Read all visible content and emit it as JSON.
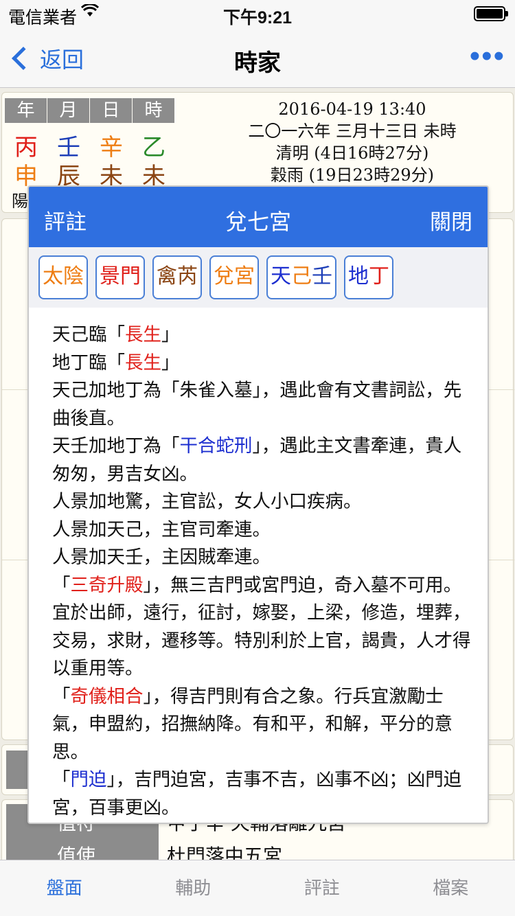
{
  "status": {
    "carrier": "電信業者",
    "time": "下午9:21"
  },
  "nav": {
    "back_label": "返回",
    "title": "時家",
    "more_label": "•••"
  },
  "info": {
    "pillar_headers": [
      "年",
      "月",
      "日",
      "時"
    ],
    "stems": [
      "丙",
      "壬",
      "辛",
      "乙"
    ],
    "branches": [
      "申",
      "辰",
      "未",
      "未"
    ],
    "yinyang": "陽",
    "datetime": "2016-04-19 13:40",
    "lunar_date": "二〇一六年 三月十三日 未時",
    "solar_term_1": "清明 (4日16時27分)",
    "solar_term_2": "穀雨 (19日23時29分)"
  },
  "bottom": {
    "row1_label": "值符",
    "row1_value": "甲子辛 天輔落離九宮",
    "row2_label": "值使",
    "row2_value": "杜門落中五宮"
  },
  "modal": {
    "left_label": "評註",
    "title": "兌七宮",
    "right_label": "關閉",
    "tags": [
      "太陰",
      "景門",
      "禽芮",
      "兌宮",
      "天己壬",
      "地丁"
    ],
    "tag_colors": {
      "太陰": "#ee7d13",
      "景門": "#e0201a",
      "禽芮": "#8b4513",
      "兌宮": "#ee7d13"
    },
    "body": {
      "l1_pre": "天己臨「",
      "l1_hl": "長生",
      "l1_post": "」",
      "l2_pre": "地丁臨「",
      "l2_hl": "長生",
      "l2_post": "」",
      "l3": "天己加地丁為「朱雀入墓」，遇此會有文書詞訟，先曲後直。",
      "l4_pre": "天壬加地丁為「",
      "l4_hl": "干合蛇刑",
      "l4_post": "」，遇此主文書牽連，貴人匆匆，男吉女凶。",
      "l5": "人景加地驚，主官訟，女人小口疾病。",
      "l6": "人景加天己，主官司牽連。",
      "l7": "人景加天壬，主因賊牽連。",
      "l8_pre": "「",
      "l8_hl": "三奇升殿",
      "l8_post": "」，無三吉門或宮門迫，奇入墓不可用。宜於出師，遠行，征討，嫁娶，上梁，修造，埋葬，交易，求財，遷移等。特別利於上官，謁貴，人才得以重用等。",
      "l9_pre": "「",
      "l9_hl": "奇儀相合",
      "l9_post": "」，得吉門則有合之象。行兵宜激勵士氣，申盟約，招撫納降。有和平，和解，平分的意思。",
      "l10_pre": "「",
      "l10_hl": "門迫",
      "l10_post": "」，吉門迫宮，吉事不吉，凶事不凶；凶門迫宮，百事更凶。"
    }
  },
  "tabs": [
    "盤面",
    "輔助",
    "評註",
    "檔案"
  ]
}
